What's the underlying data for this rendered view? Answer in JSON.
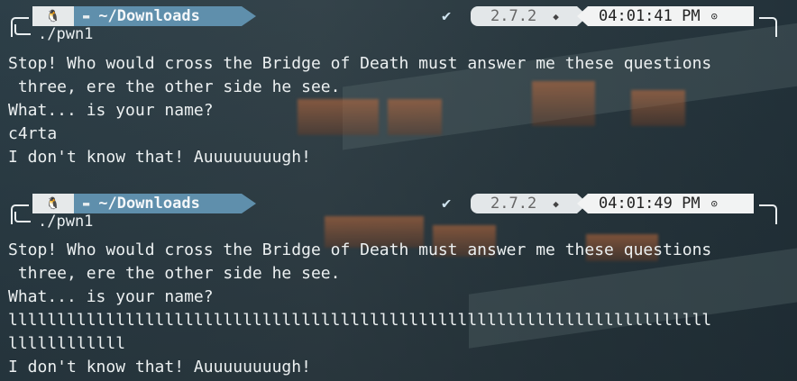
{
  "prompts": [
    {
      "os_icon": "tux-icon",
      "dir": "~/Downloads",
      "status": "✔",
      "version": "2.7.2",
      "time": "04:01:41 PM",
      "command": "./pwn1",
      "output": [
        "Stop! Who would cross the Bridge of Death must answer me these questions",
        " three, ere the other side he see.",
        "What... is your name?",
        "c4rta",
        "I don't know that! Auuuuuuuugh!"
      ]
    },
    {
      "os_icon": "tux-icon",
      "dir": "~/Downloads",
      "status": "✔",
      "version": "2.7.2",
      "time": "04:01:49 PM",
      "command": "./pwn1",
      "output": [
        "Stop! Who would cross the Bridge of Death must answer me these questions",
        " three, ere the other side he see.",
        "What... is your name?",
        "llllllllllllllllllllllllllllllllllllllllllllllllllllllllllllllllllllllll",
        "llllllllllll",
        "I don't know that! Auuuuuuuugh!"
      ]
    }
  ],
  "colors": {
    "dir_segment": "#5f8fac",
    "version_segment": "#e3e7e9",
    "time_segment": "#f2f3f3"
  }
}
